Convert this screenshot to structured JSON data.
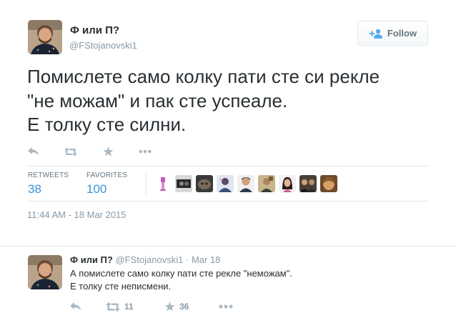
{
  "tweet": {
    "author": {
      "name": "Ф или П?",
      "handle": "@FStojanovski1",
      "avatar_icon": "user-avatar"
    },
    "follow_button": {
      "label": "Follow",
      "icon": "add-user-icon"
    },
    "text_lines": [
      "Помислете само колку пати сте си рекле",
      "\"не можам\" и пак сте успеале.",
      "Е толку сте силни."
    ],
    "actions": [
      "reply-icon",
      "retweet-icon",
      "favorite-icon",
      "more-icon"
    ],
    "stats": {
      "retweets_label": "RETWEETS",
      "retweets_value": "38",
      "favorites_label": "FAVORITES",
      "favorites_value": "100"
    },
    "favoriter_avatar_count": 9,
    "timestamp": "11:44 AM - 18 Mar 2015"
  },
  "reply": {
    "name": "Ф или П?",
    "handle": "@FStojanovski1",
    "separator": "·",
    "date": "Mar 18",
    "text_lines": [
      "А помислете само колку пати сте рекле \"неможам\".",
      "Е толку сте неписмени."
    ],
    "retweet_count": "11",
    "favorite_count": "36"
  },
  "colors": {
    "text": "#292f33",
    "muted": "#8899a6",
    "link_blue": "#3b94d9",
    "icon_gray": "#aab8c2",
    "border": "#e1e8ed"
  }
}
